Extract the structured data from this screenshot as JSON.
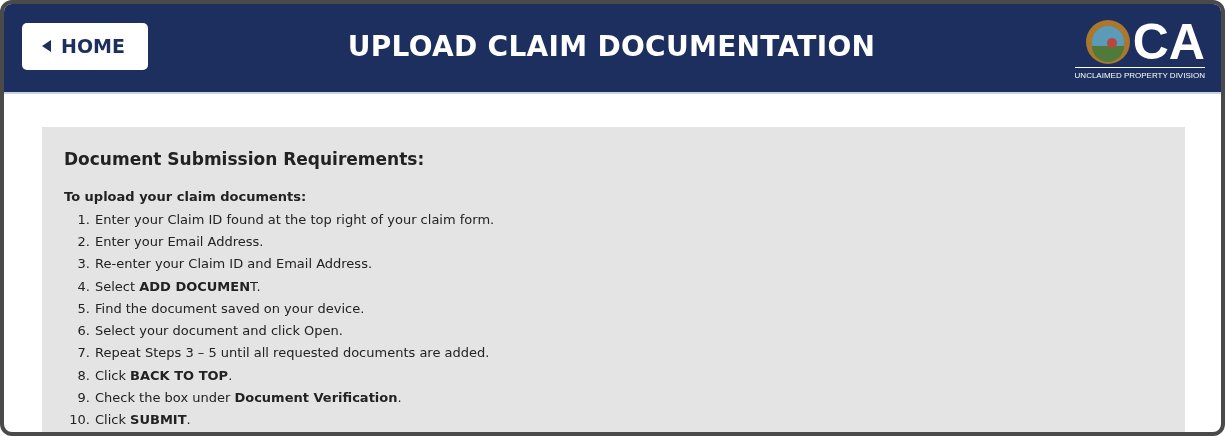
{
  "header": {
    "home_button": "HOME",
    "title": "UPLOAD CLAIM DOCUMENTATION",
    "logo_text": "CA",
    "logo_caption": "UNCLAIMED PROPERTY DIVISION"
  },
  "panel": {
    "heading": "Document Submission Requirements:",
    "intro": "To upload your claim documents:",
    "steps": [
      {
        "number": "1.",
        "text": "Enter your Claim ID found at the top right of your claim form."
      },
      {
        "number": "2.",
        "text": "Enter your Email Address."
      },
      {
        "number": "3.",
        "text": "Re-enter your Claim ID and Email Address."
      },
      {
        "number": "4.",
        "text": "Select **ADD DOCUMEN**T."
      },
      {
        "number": "5.",
        "text": "Find the document saved on your device."
      },
      {
        "number": "6.",
        "text": "Select your document and click Open."
      },
      {
        "number": "7.",
        "text": "Repeat Steps 3 – 5 until all requested documents are added."
      },
      {
        "number": "8.",
        "text": "Click **BACK TO TOP**."
      },
      {
        "number": "9.",
        "text": "Check the box under **Document Verification**."
      },
      {
        "number": "10.",
        "text": "Click **SUBMIT**."
      }
    ]
  }
}
